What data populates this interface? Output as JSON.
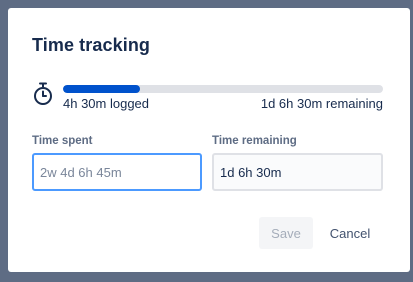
{
  "dialog": {
    "title": "Time tracking",
    "progress": {
      "logged_fraction": 0.24,
      "logged_label": "4h 30m logged",
      "remaining_label": "1d 6h 30m remaining"
    },
    "fields": {
      "time_spent": {
        "label": "Time spent",
        "value": "",
        "placeholder": "2w 4d 6h 45m"
      },
      "time_remaining": {
        "label": "Time remaining",
        "value": "1d 6h 30m"
      }
    },
    "buttons": {
      "save_label": "Save",
      "cancel_label": "Cancel"
    }
  },
  "icons": {
    "progress_icon": "stopwatch-icon"
  },
  "colors": {
    "progress_fill": "#0052cc",
    "progress_track": "#dfe1e6",
    "focus_border": "#4c9aff",
    "title_text": "#172b4d"
  }
}
